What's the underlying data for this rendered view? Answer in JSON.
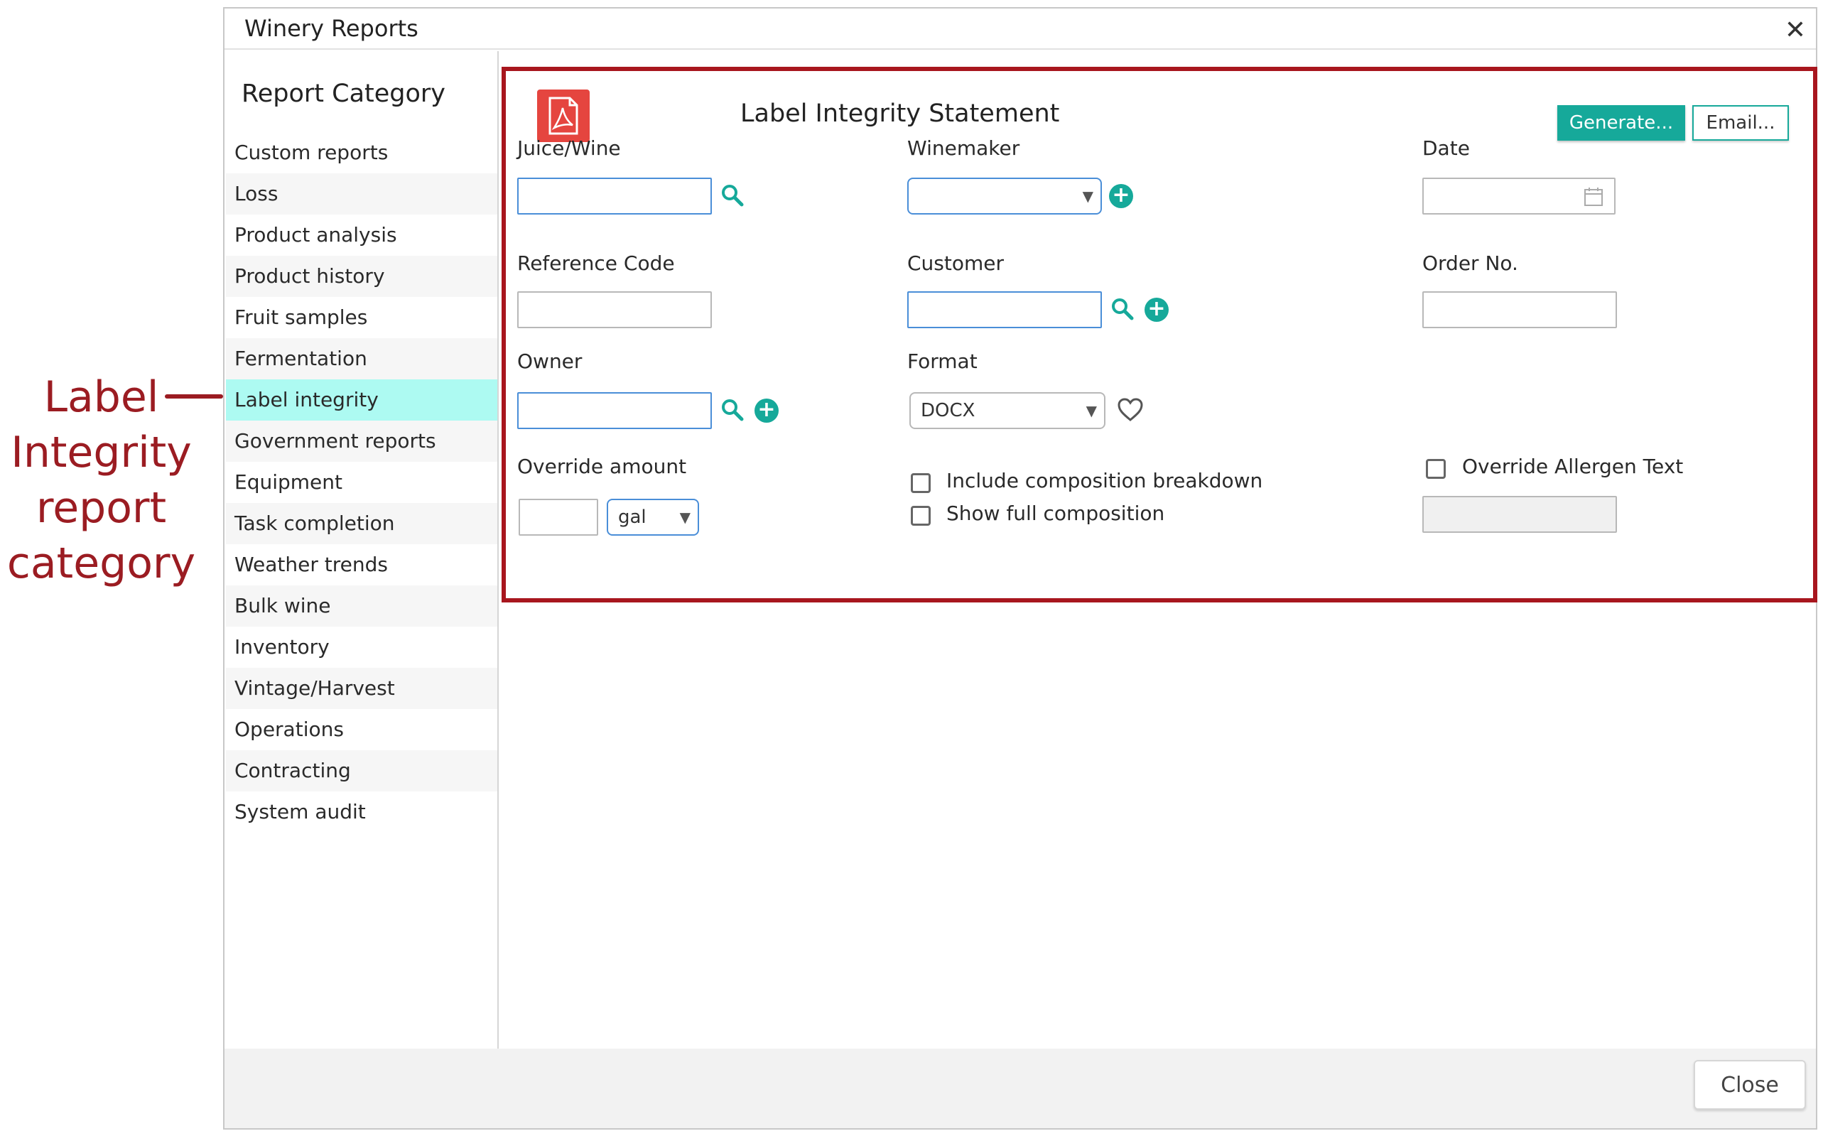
{
  "annotation": {
    "lines": [
      "Label",
      "Integrity",
      "report",
      "category"
    ]
  },
  "dialog": {
    "title": "Winery Reports",
    "close_label": "Close"
  },
  "sidebar": {
    "title": "Report Category",
    "items": [
      {
        "label": "Custom reports"
      },
      {
        "label": "Loss"
      },
      {
        "label": "Product analysis"
      },
      {
        "label": "Product history"
      },
      {
        "label": "Fruit samples"
      },
      {
        "label": "Fermentation"
      },
      {
        "label": "Label integrity",
        "active": true
      },
      {
        "label": "Government reports"
      },
      {
        "label": "Equipment"
      },
      {
        "label": "Task completion"
      },
      {
        "label": "Weather trends"
      },
      {
        "label": "Bulk wine"
      },
      {
        "label": "Inventory"
      },
      {
        "label": "Vintage/Harvest"
      },
      {
        "label": "Operations"
      },
      {
        "label": "Contracting"
      },
      {
        "label": "System audit"
      }
    ]
  },
  "report": {
    "title": "Label Integrity Statement",
    "generate_label": "Generate...",
    "email_label": "Email...",
    "fields": {
      "juice_wine": {
        "label": "Juice/Wine",
        "value": ""
      },
      "winemaker": {
        "label": "Winemaker",
        "value": ""
      },
      "date": {
        "label": "Date",
        "value": ""
      },
      "reference_code": {
        "label": "Reference Code",
        "value": ""
      },
      "customer": {
        "label": "Customer",
        "value": ""
      },
      "order_no": {
        "label": "Order No.",
        "value": ""
      },
      "owner": {
        "label": "Owner",
        "value": ""
      },
      "format": {
        "label": "Format",
        "value": "DOCX"
      },
      "override_amount": {
        "label": "Override amount",
        "value": "",
        "unit": "gal"
      },
      "include_composition": {
        "label": "Include composition breakdown",
        "checked": false
      },
      "show_full_composition": {
        "label": "Show full composition",
        "checked": false
      },
      "override_allergen": {
        "label": "Override Allergen Text",
        "checked": false,
        "value": ""
      }
    }
  },
  "colors": {
    "accent": "#16a99a",
    "highlight": "#a8161e",
    "active_item": "#adfaf2"
  }
}
